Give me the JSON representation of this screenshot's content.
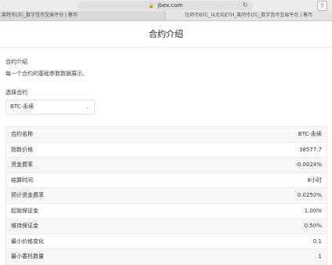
{
  "browser": {
    "url": "jbex.com",
    "tabs": [
      {
        "label": "莱特币LTC_数字货币交易平台 | 聚币"
      },
      {
        "label": "比特币BTC_以太坊ETH_莱特币LTC_数字货币交易平台 | 聚币"
      }
    ]
  },
  "page": {
    "title": "合约介绍",
    "intro_label": "合约介绍",
    "intro_desc": "每一个合约的基础参数数据展示。",
    "select_label": "选择合约",
    "select_value": "BTC-永续"
  },
  "table": {
    "rows": [
      {
        "name": "合约名称",
        "value": "BTC-永续"
      },
      {
        "name": "指数价格",
        "value": "38577.7"
      },
      {
        "name": "资金费率",
        "value": "-0.0024%"
      },
      {
        "name": "结算时间",
        "value": "8小时"
      },
      {
        "name": "预计资金费率",
        "value": "0.0250%"
      },
      {
        "name": "起始保证金",
        "value": "1.00%"
      },
      {
        "name": "维持保证金",
        "value": "0.50%"
      },
      {
        "name": "最小价格变化",
        "value": "0.1"
      },
      {
        "name": "最小委托数量",
        "value": "1"
      }
    ]
  },
  "icons": {
    "lock": "lock-icon",
    "reload": "reload-icon",
    "share": "share-icon",
    "caret": "chevron-down-icon"
  }
}
